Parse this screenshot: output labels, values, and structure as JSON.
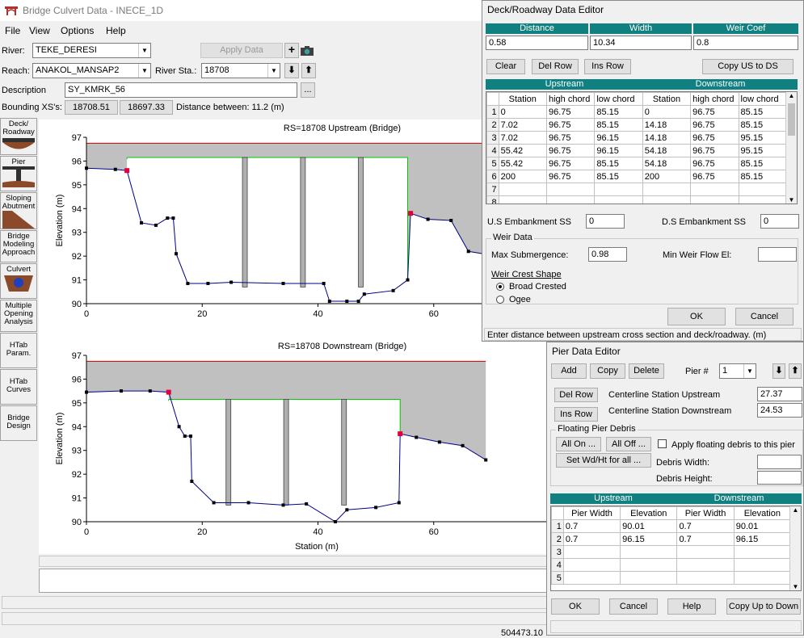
{
  "app": {
    "title": "Bridge Culvert Data - INECE_1D"
  },
  "menu": [
    "File",
    "View",
    "Options",
    "Help"
  ],
  "river": {
    "label": "River:",
    "value": "TEKE_DERESI"
  },
  "reach": {
    "label": "Reach:",
    "value": "ANAKOL_MANSAP2"
  },
  "river_sta": {
    "label": "River Sta.:",
    "value": "18708"
  },
  "apply_label": "Apply Data",
  "description": {
    "label": "Description",
    "value": "SY_KMRK_56",
    "browse": "..."
  },
  "bounding": {
    "label": "Bounding XS's:",
    "up": "18708.51",
    "down": "18697.33",
    "distance": "Distance between: 11.2 (m)"
  },
  "tools": [
    {
      "name": "tool-deck-roadway",
      "label": "Deck/ Roadway"
    },
    {
      "name": "tool-pier",
      "label": "Pier"
    },
    {
      "name": "tool-sloping-abutment",
      "label": "Sloping Abutment"
    },
    {
      "name": "tool-bridge-modeling",
      "label": "Bridge Modeling Approach"
    },
    {
      "name": "tool-culvert",
      "label": "Culvert"
    },
    {
      "name": "tool-multiple-opening",
      "label": "Multiple Opening Analysis"
    },
    {
      "name": "tool-htab-param",
      "label": "HTab Param."
    },
    {
      "name": "tool-htab-curves",
      "label": "HTab Curves"
    },
    {
      "name": "tool-bridge-design",
      "label": "Bridge Design"
    }
  ],
  "plots": {
    "upstream_title": "RS=18708  Upstream  (Bridge)",
    "downstream_title": "RS=18708  Downstream  (Bridge)",
    "ylabel": "Elevation (m)",
    "xlabel": "Station (m)"
  },
  "chart_data": [
    {
      "type": "line",
      "title": "RS=18708  Upstream  (Bridge)",
      "ylabel": "Elevation (m)",
      "xlim": [
        0,
        80
      ],
      "ylim": [
        90,
        97
      ],
      "xticks": [
        "0",
        "20",
        "40",
        "60"
      ],
      "yticks": [
        "90",
        "91",
        "92",
        "93",
        "94",
        "95",
        "96",
        "97"
      ],
      "ground": [
        [
          0,
          95.7
        ],
        [
          5,
          95.65
        ],
        [
          7,
          95.6
        ],
        [
          9.5,
          93.4
        ],
        [
          12,
          93.3
        ],
        [
          14,
          93.6
        ],
        [
          15,
          93.6
        ],
        [
          15.5,
          92.1
        ],
        [
          17.5,
          90.85
        ],
        [
          21,
          90.85
        ],
        [
          25,
          90.9
        ],
        [
          34,
          90.85
        ],
        [
          41,
          90.85
        ],
        [
          42,
          90.1
        ],
        [
          45,
          90.1
        ],
        [
          47,
          90.1
        ],
        [
          48,
          90.4
        ],
        [
          53,
          90.55
        ],
        [
          55.5,
          91.0
        ],
        [
          56,
          93.8
        ],
        [
          59,
          93.55
        ],
        [
          63,
          93.5
        ],
        [
          66,
          92.2
        ],
        [
          71,
          92.0
        ]
      ],
      "deck": {
        "station_left": 0,
        "station_right": 80,
        "high_chord": 96.75,
        "low_chord": 96.15,
        "opening_left": 7,
        "opening_right": 55.5
      },
      "piers": [
        27.37,
        37.4,
        47.4
      ],
      "ineffective_markers": [
        [
          7,
          95.6
        ],
        [
          56,
          93.8
        ]
      ]
    },
    {
      "type": "line",
      "title": "RS=18708  Downstream  (Bridge)",
      "ylabel": "Elevation (m)",
      "xlabel": "Station (m)",
      "xlim": [
        0,
        80
      ],
      "ylim": [
        90,
        97
      ],
      "xticks": [
        "0",
        "20",
        "40",
        "60"
      ],
      "yticks": [
        "90",
        "91",
        "92",
        "93",
        "94",
        "95",
        "96",
        "97"
      ],
      "ground": [
        [
          0,
          95.45
        ],
        [
          6,
          95.5
        ],
        [
          11,
          95.5
        ],
        [
          14.2,
          95.45
        ],
        [
          16,
          94.0
        ],
        [
          17,
          93.6
        ],
        [
          18,
          93.6
        ],
        [
          18.2,
          91.7
        ],
        [
          22,
          90.8
        ],
        [
          28,
          90.8
        ],
        [
          34,
          90.7
        ],
        [
          38,
          90.75
        ],
        [
          43,
          90.0
        ],
        [
          45,
          90.5
        ],
        [
          50,
          90.6
        ],
        [
          54,
          90.8
        ],
        [
          54.2,
          93.7
        ],
        [
          57,
          93.55
        ],
        [
          61,
          93.35
        ],
        [
          65,
          93.2
        ],
        [
          69,
          92.6
        ]
      ],
      "deck": {
        "station_left": 0,
        "station_right": 69,
        "high_chord": 96.75,
        "low_chord": 95.15,
        "opening_left": 14.2,
        "opening_right": 54.2
      },
      "piers": [
        24.53,
        34.5,
        44.5
      ],
      "ineffective_markers": [
        [
          14.2,
          95.45
        ],
        [
          54.2,
          93.7
        ]
      ]
    }
  ],
  "deck_editor": {
    "title": "Deck/Roadway Data Editor",
    "headers": [
      "Distance",
      "Width",
      "Weir Coef"
    ],
    "values": [
      "0.58",
      "10.34",
      "0.8"
    ],
    "buttons": {
      "clear": "Clear",
      "del_row": "Del Row",
      "ins_row": "Ins Row",
      "copy": "Copy US to DS"
    },
    "table_headers": {
      "upstream": "Upstream",
      "downstream": "Downstream"
    },
    "columns": [
      "Station",
      "high chord",
      "low chord",
      "Station",
      "high chord",
      "low chord"
    ],
    "rows": [
      [
        "1",
        "0",
        "96.75",
        "85.15",
        "0",
        "96.75",
        "85.15"
      ],
      [
        "2",
        "7.02",
        "96.75",
        "85.15",
        "14.18",
        "96.75",
        "85.15"
      ],
      [
        "3",
        "7.02",
        "96.75",
        "96.15",
        "14.18",
        "96.75",
        "95.15"
      ],
      [
        "4",
        "55.42",
        "96.75",
        "96.15",
        "54.18",
        "96.75",
        "95.15"
      ],
      [
        "5",
        "55.42",
        "96.75",
        "85.15",
        "54.18",
        "96.75",
        "85.15"
      ],
      [
        "6",
        "200",
        "96.75",
        "85.15",
        "200",
        "96.75",
        "85.15"
      ],
      [
        "7",
        "",
        "",
        "",
        "",
        "",
        ""
      ],
      [
        "8",
        "",
        "",
        "",
        "",
        "",
        ""
      ]
    ],
    "us_embankment": {
      "label": "U.S Embankment SS",
      "value": "0"
    },
    "ds_embankment": {
      "label": "D.S Embankment SS",
      "value": "0"
    },
    "weir_data": "Weir Data",
    "max_submergence": {
      "label": "Max  Submergence:",
      "value": "0.98"
    },
    "min_weir_flow": {
      "label": "Min Weir Flow El:",
      "value": ""
    },
    "weir_crest_shape": "Weir Crest Shape",
    "broad_crested": "Broad Crested",
    "ogee": "Ogee",
    "ok": "OK",
    "cancel": "Cancel",
    "status": "Enter distance between upstream cross section and deck/roadway. (m)"
  },
  "pier_editor": {
    "title": "Pier Data Editor",
    "add": "Add",
    "copy": "Copy",
    "delete": "Delete",
    "pier_num_label": "Pier #",
    "pier_num": "1",
    "del_row": "Del Row",
    "ins_row": "Ins Row",
    "cl_up": {
      "label": "Centerline Station Upstream",
      "value": "27.37"
    },
    "cl_down": {
      "label": "Centerline Station Downstream",
      "value": "24.53"
    },
    "floating_debris": "Floating Pier Debris",
    "all_on": "All On ...",
    "all_off": "All Off ...",
    "apply_debris": "Apply floating debris to this pier",
    "set_wdht": "Set Wd/Ht for all ...",
    "debris_width": "Debris Width:",
    "debris_height": "Debris Height:",
    "table_headers": {
      "upstream": "Upstream",
      "downstream": "Downstream"
    },
    "columns": [
      "Pier Width",
      "Elevation",
      "Pier Width",
      "Elevation"
    ],
    "rows": [
      [
        "1",
        "0.7",
        "90.01",
        "0.7",
        "90.01"
      ],
      [
        "2",
        "0.7",
        "96.15",
        "0.7",
        "96.15"
      ],
      [
        "3",
        "",
        "",
        "",
        ""
      ],
      [
        "4",
        "",
        "",
        "",
        ""
      ],
      [
        "5",
        "",
        "",
        "",
        ""
      ]
    ],
    "ok": "OK",
    "cancel": "Cancel",
    "help": "Help",
    "copy_up_down": "Copy Up to Down"
  },
  "status": {
    "coords": "504473.10"
  },
  "colors": {
    "grid_header": "#108080",
    "deck_fill": "#c0c0c0",
    "ground": "#00008b",
    "opening": "#00c800",
    "top_line": "#d00000",
    "marker": "#e0003c"
  }
}
